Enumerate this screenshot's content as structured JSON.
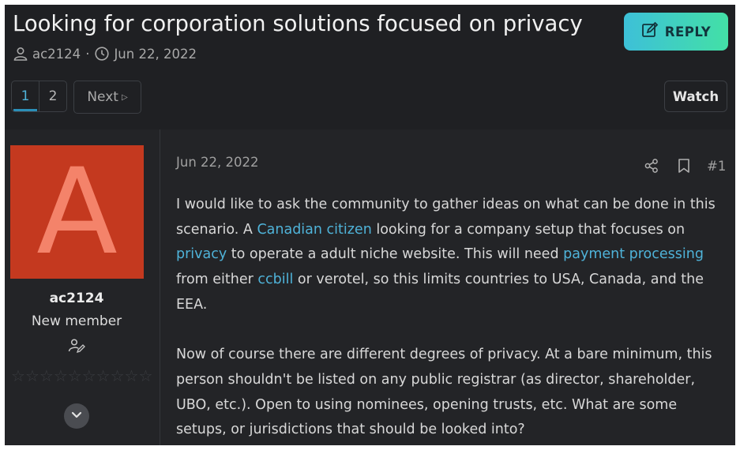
{
  "thread": {
    "title": "Looking for corporation solutions focused on privacy",
    "author": "ac2124",
    "separator": "·",
    "date": "Jun 22, 2022"
  },
  "toolbar": {
    "reply_label": "REPLY",
    "watch_label": "Watch"
  },
  "pagination": {
    "pages": [
      "1",
      "2"
    ],
    "current": "1",
    "next_label": "Next"
  },
  "post": {
    "user": {
      "avatar_letter": "A",
      "avatar_bg": "#c4391f",
      "avatar_fg": "#f4836a",
      "username": "ac2124",
      "user_title": "New member",
      "reaction_stars": 0
    },
    "date": "Jun 22, 2022",
    "number": "#1",
    "p1": {
      "t1": "I would like to ask the community to gather ideas on what can be done in this scenario. A ",
      "l1": "Canadian citizen",
      "t2": " looking for a company setup that focuses on ",
      "l2": "privacy",
      "t3": " to operate a adult niche website. This will need ",
      "l3": "payment processing",
      "t4": " from either ",
      "l4": "ccbill",
      "t5": " or verotel, so this limits countries to USA, Canada, and the EEA."
    },
    "p2": "Now of course there are different degrees of privacy. At a bare minimum, this person shouldn't be listed on any public registrar (as director, shareholder, UBO, etc.). Open to using nominees, opening trusts, etc. What are some setups, or jurisdictions that should be looked into?"
  },
  "colors": {
    "background": "#1f2023",
    "panel": "#232427",
    "accent_link": "#4fb3d9",
    "reply_gradient_start": "#3dc0d8",
    "reply_gradient_end": "#43e0a6"
  },
  "icons": [
    "user-icon",
    "clock-icon",
    "edit-icon",
    "next-arrow-icon",
    "share-icon",
    "bookmark-icon",
    "user-edit-icon",
    "star-icon",
    "chevron-down-icon"
  ]
}
